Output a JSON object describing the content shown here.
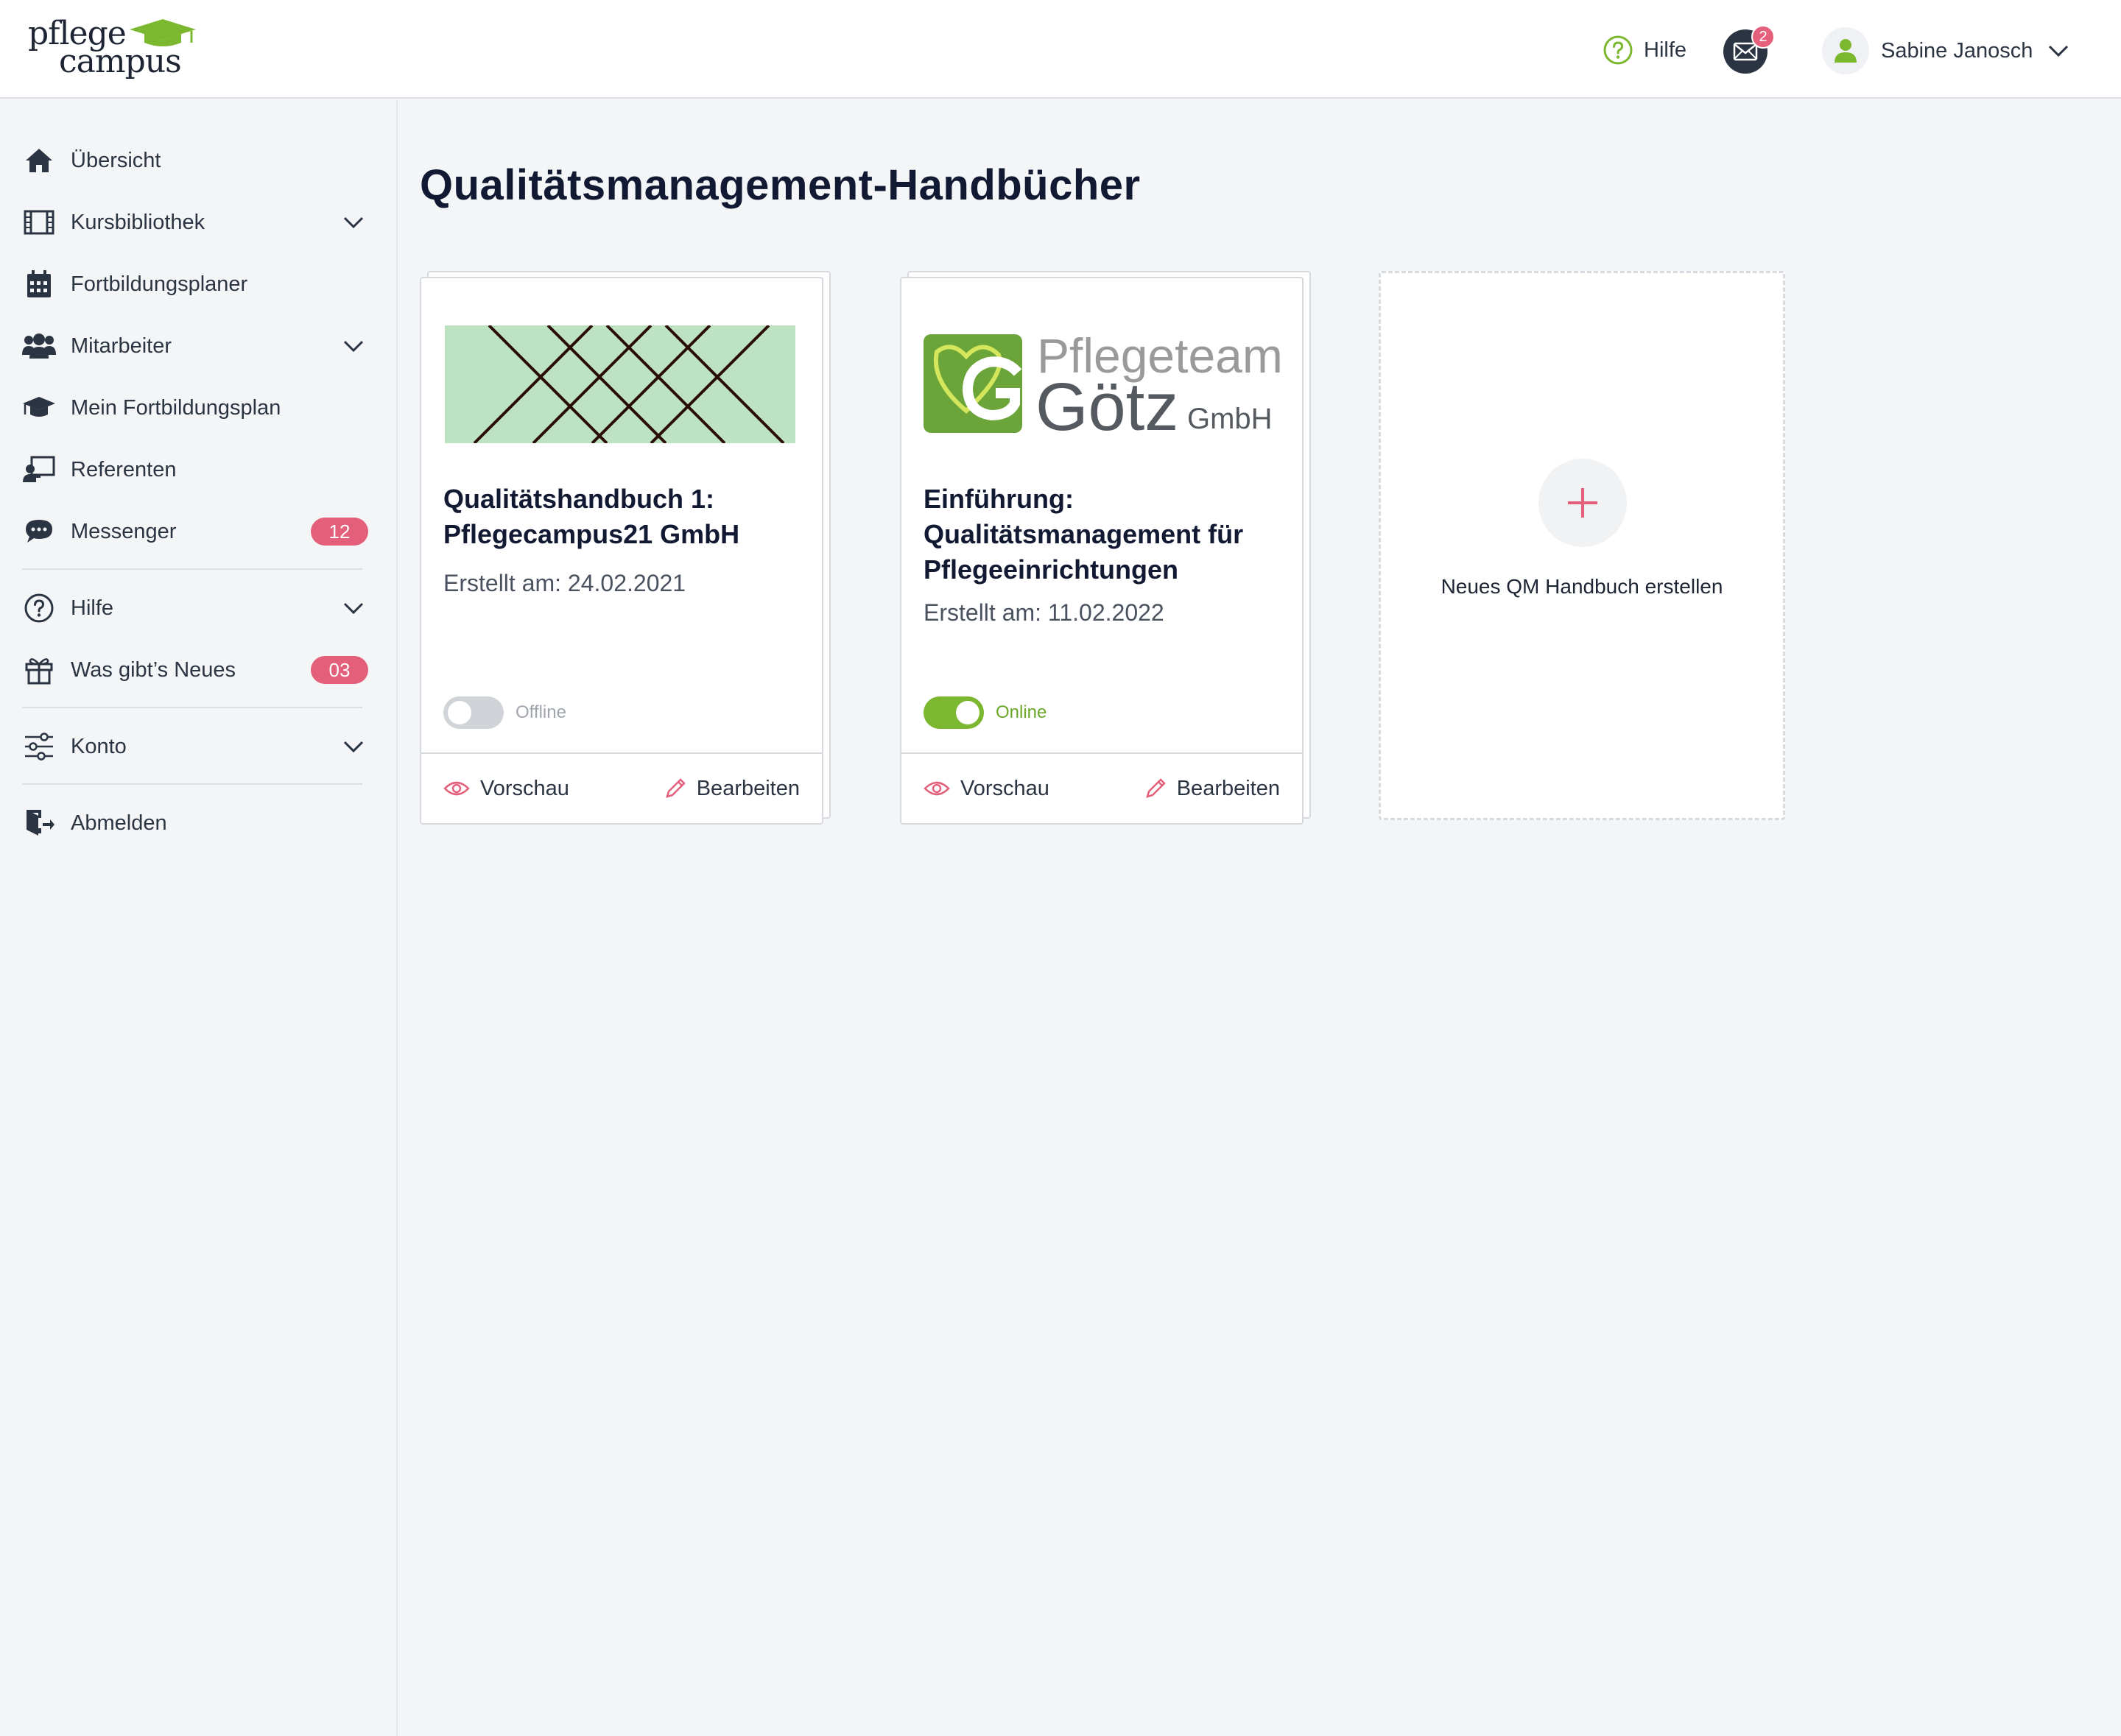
{
  "header": {
    "logo_line1": "pflege",
    "logo_line2": "campus",
    "help_label": "Hilfe",
    "mail_count": "2",
    "user_name": "Sabine Janosch"
  },
  "sidebar": {
    "items": [
      {
        "label": "Übersicht",
        "icon": "home-icon"
      },
      {
        "label": "Kursbibliothek",
        "icon": "film-icon"
      },
      {
        "label": "Fortbildungsplaner",
        "icon": "calendar-icon"
      },
      {
        "label": "Mitarbeiter",
        "icon": "users-icon"
      },
      {
        "label": "Mein Fortbildungsplan",
        "icon": "graduation-cap-icon"
      },
      {
        "label": "Referenten",
        "icon": "presenter-icon"
      },
      {
        "label": "Messenger",
        "icon": "chat-icon",
        "badge": "12"
      },
      {
        "label": "Hilfe",
        "icon": "help-circle-icon"
      },
      {
        "label": "Was gibt’s Neues",
        "icon": "gift-icon",
        "badge": "03"
      },
      {
        "label": "Konto",
        "icon": "sliders-icon"
      },
      {
        "label": "Abmelden",
        "icon": "logout-icon"
      }
    ]
  },
  "main": {
    "title": "Qualitätsmanagement-Handbücher",
    "cards": [
      {
        "title": "Qualitätshandbuch 1: Pflegecampus21 GmbH",
        "date": "Erstellt am: 24.02.2021",
        "status": "Offline",
        "online": false,
        "preview_label": "Vorschau",
        "edit_label": "Bearbeiten"
      },
      {
        "logo_line1": "Pflegeteam",
        "logo_line2": "Götz",
        "logo_line3": "GmbH",
        "title": "Einführung: Qualitätsmanagement für Pflegeeinrichtungen",
        "date": "Erstellt am: 11.02.2022",
        "status": "Online",
        "online": true,
        "preview_label": "Vorschau",
        "edit_label": "Bearbeiten"
      }
    ],
    "new_card_label": "Neues QM Handbuch erstellen"
  },
  "colors": {
    "accent_pink": "#e4607a",
    "brand_green": "#7cb82f",
    "dark_text": "#121a33"
  }
}
